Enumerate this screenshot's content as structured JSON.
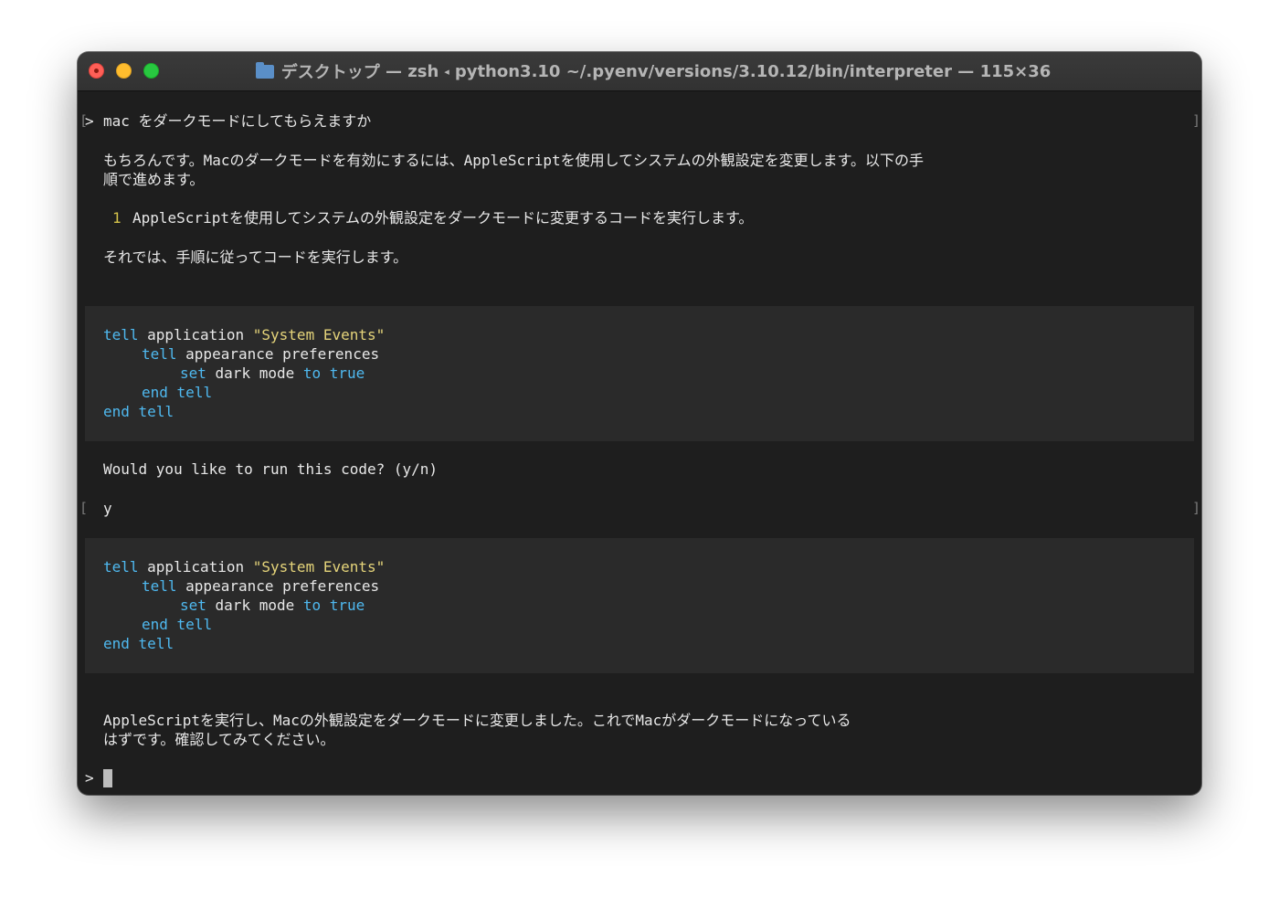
{
  "titlebar": {
    "folder": "デスクトップ",
    "sep1": "—",
    "shell": "zsh",
    "arrow": "◂",
    "process": "python3.10 ~/.pyenv/versions/3.10.12/bin/interpreter",
    "sep2": "—",
    "size": "115×36"
  },
  "transcript": {
    "user_prompt_marker": ">",
    "user_message": "mac をダークモードにしてもらえますか",
    "reply_line1": "もちろんです。Macのダークモードを有効にするには、AppleScriptを使用してシステムの外観設定を変更します。以下の手",
    "reply_line2": "順で進めます。",
    "step_number": "1",
    "step_text": "AppleScriptを使用してシステムの外観設定をダークモードに変更するコードを実行します。",
    "then_text": "それでは、手順に従ってコードを実行します。",
    "code": {
      "kw_tell": "tell",
      "application": " application ",
      "app_name": "\"System Events\"",
      "appearance": " appearance preferences",
      "kw_set": "set",
      "dark_mode": " dark mode ",
      "kw_to": "to",
      "kw_true": "true",
      "kw_end": "end"
    },
    "confirm_question": "Would you like to run this code? (y/n)",
    "confirm_answer": "y",
    "result_line1": "AppleScriptを実行し、Macの外観設定をダークモードに変更しました。これでMacがダークモードになっている",
    "result_line2": "はずです。確認してみてください。",
    "input_prompt": ">"
  },
  "colors": {
    "keyword": "#4fb9f0",
    "string": "#e5d47a",
    "step_number": "#d4c24a",
    "background": "#1e1e1e",
    "code_background": "#2a2a2a"
  }
}
